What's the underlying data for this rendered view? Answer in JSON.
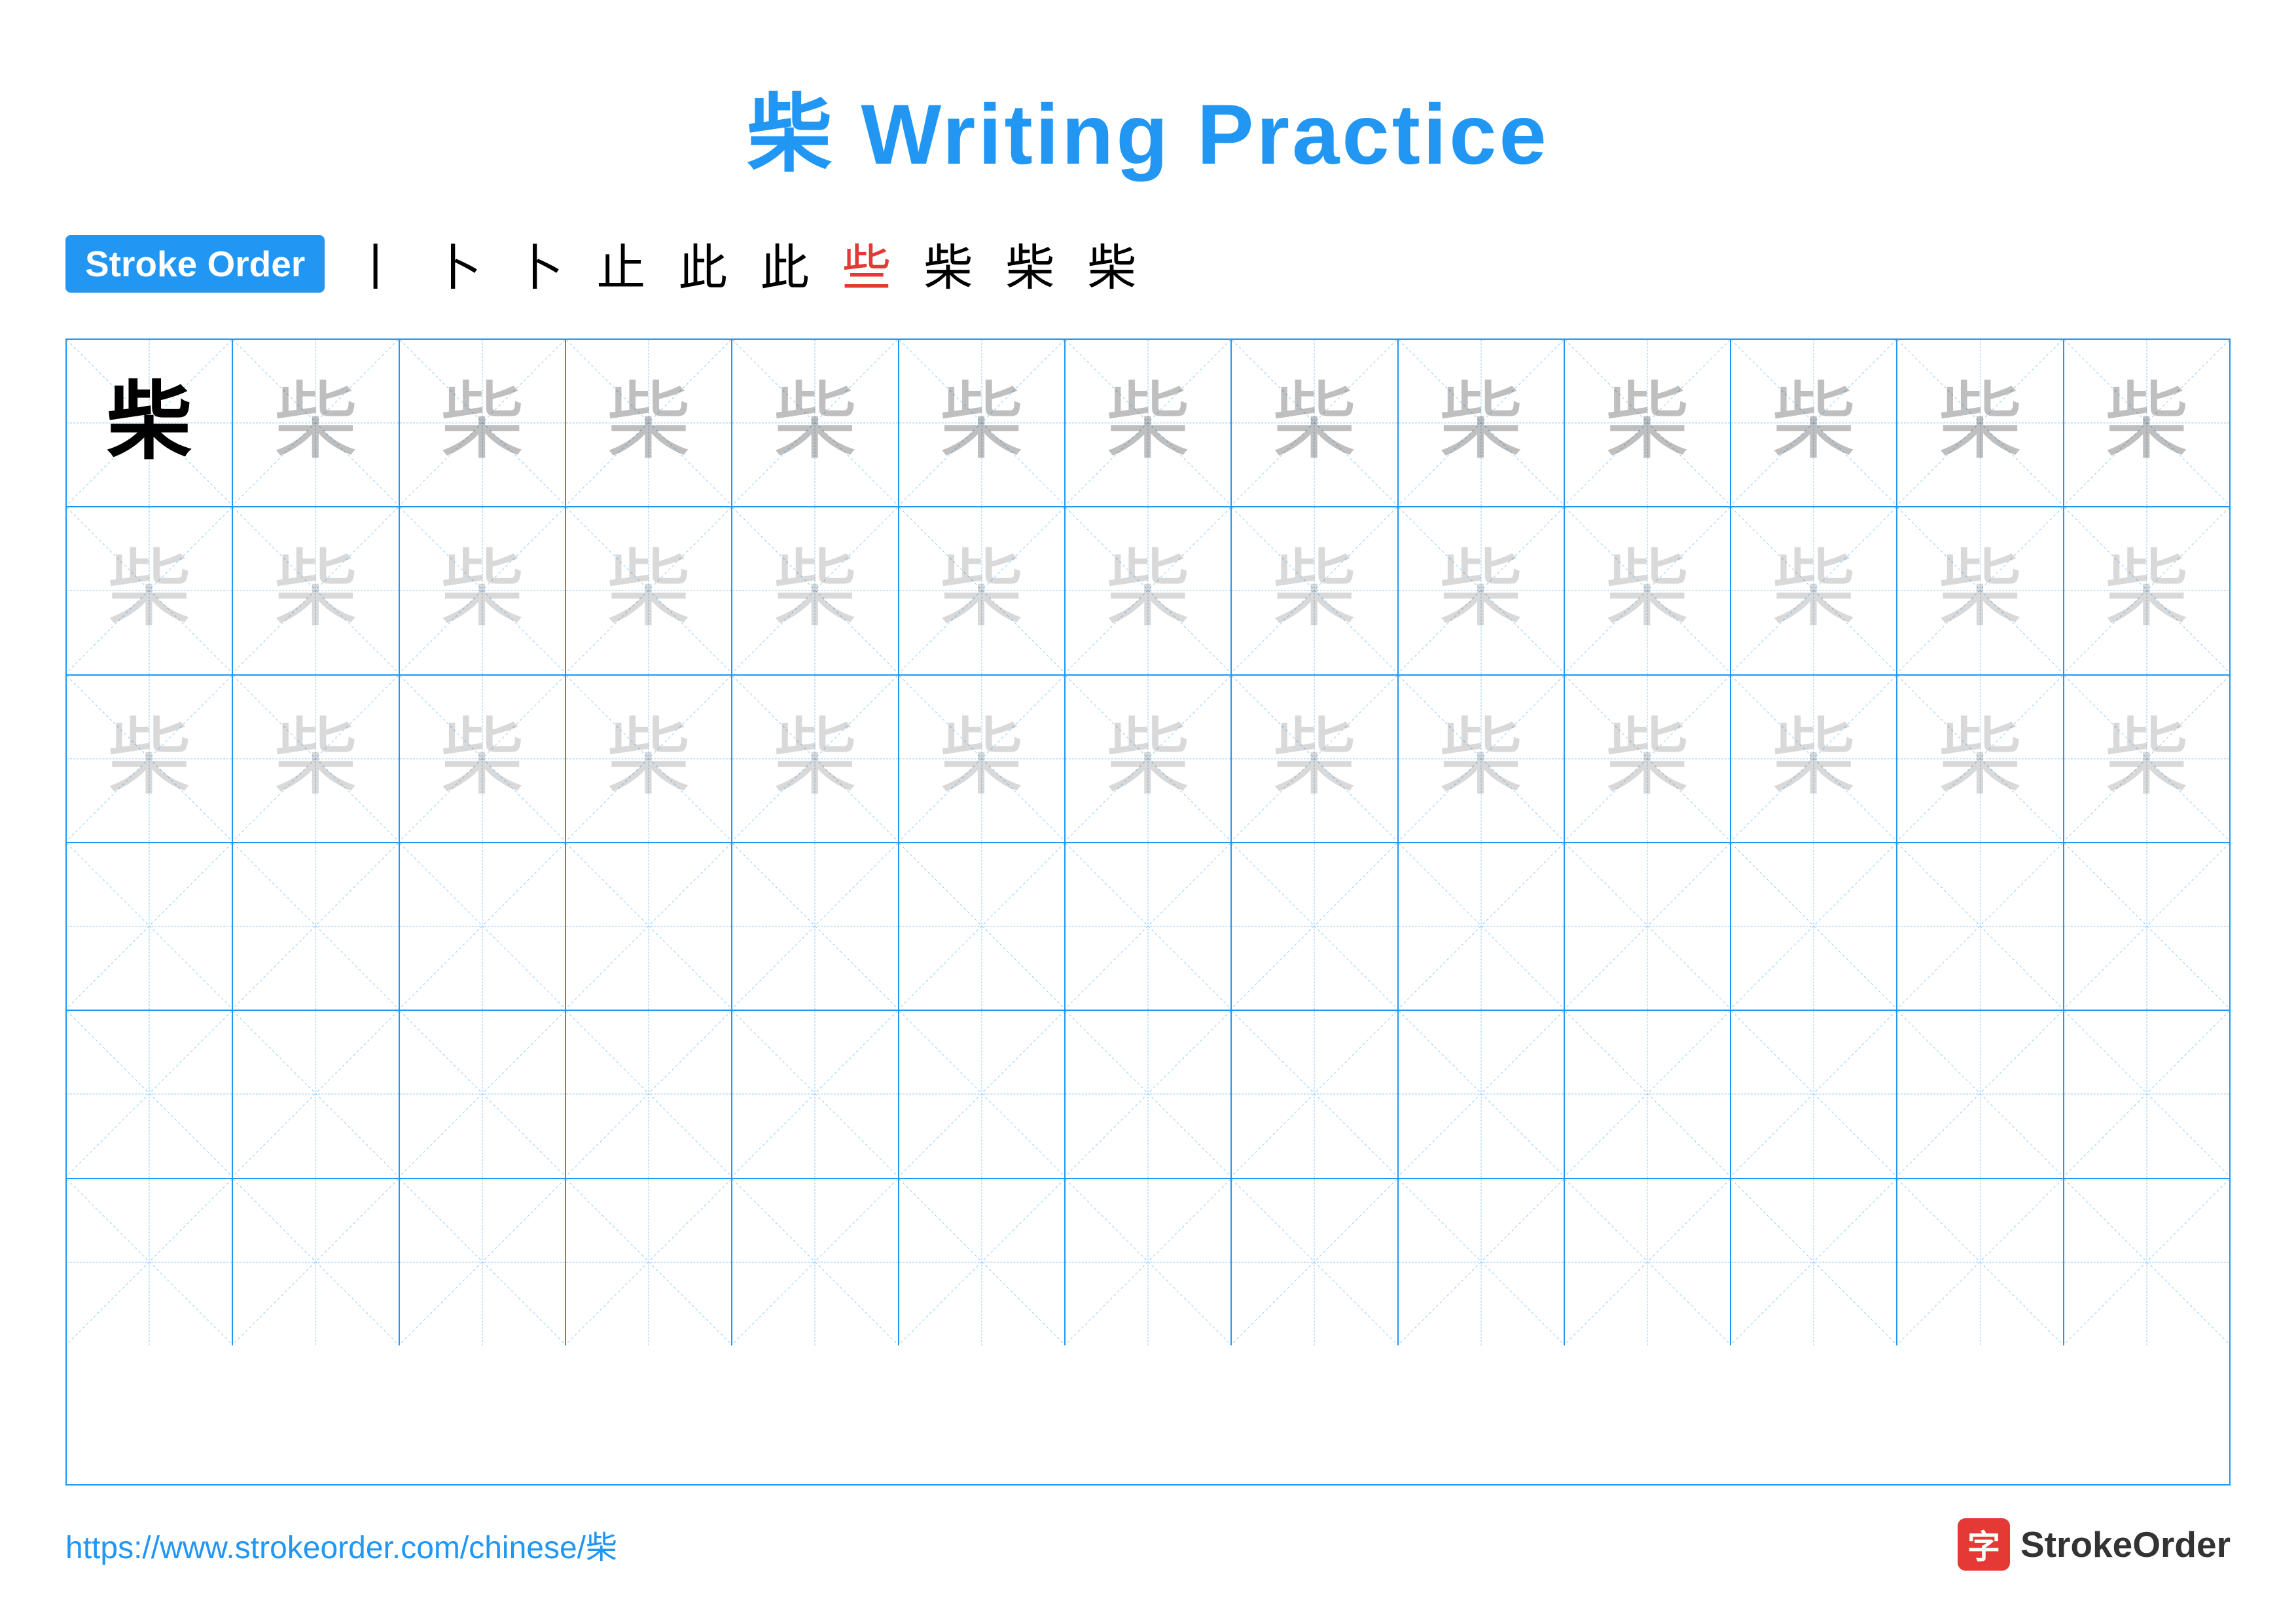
{
  "title": "柴 Writing Practice",
  "stroke_order": {
    "badge_label": "Stroke Order",
    "steps": [
      "丨",
      "卜",
      "卜",
      "止",
      "此",
      "此",
      "些",
      "柴",
      "柴",
      "柴"
    ]
  },
  "character": "柴",
  "rows": [
    {
      "type": "example_plus_guide",
      "example": true,
      "count": 13
    },
    {
      "type": "guide_only",
      "count": 13
    },
    {
      "type": "guide_only",
      "count": 13
    },
    {
      "type": "empty",
      "count": 13
    },
    {
      "type": "empty",
      "count": 13
    },
    {
      "type": "empty",
      "count": 13
    }
  ],
  "footer": {
    "url": "https://www.strokeorder.com/chinese/柴",
    "logo_char": "字",
    "logo_text": "StrokeOrder"
  }
}
